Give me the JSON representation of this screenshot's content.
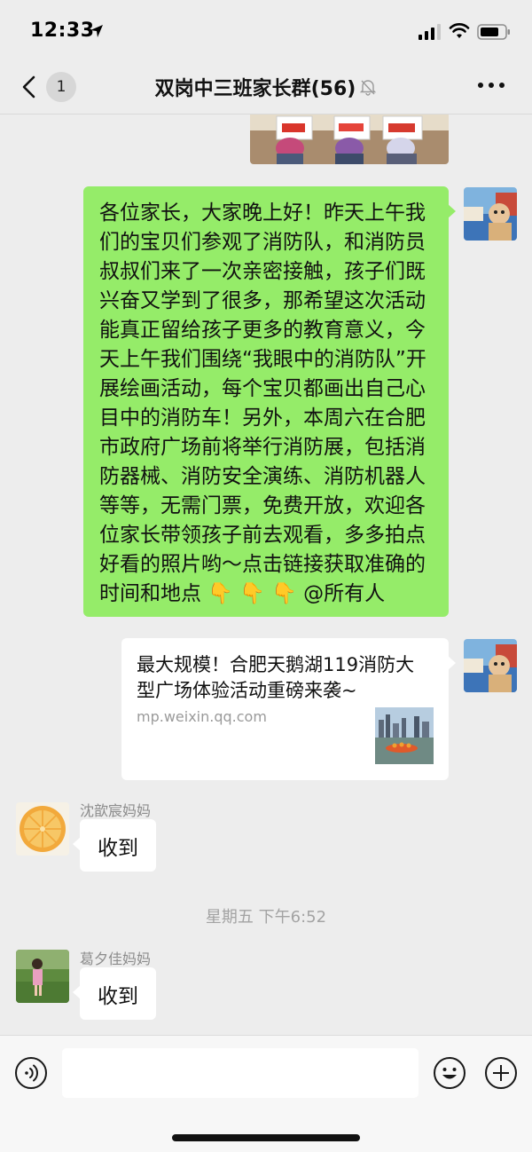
{
  "status_bar": {
    "time": "12:33",
    "icons": [
      "location-arrow-icon",
      "signal-icon",
      "wifi-icon",
      "battery-icon"
    ]
  },
  "nav": {
    "back_badge": "1",
    "title": "双岗中三班家长群(56)",
    "icons": [
      "back-chevron-icon",
      "mute-bell-icon",
      "more-dots-icon"
    ]
  },
  "messages": {
    "announcement": "各位家长，大家晚上好！昨天上午我们的宝贝们参观了消防队，和消防员叔叔们来了一次亲密接触，孩子们既兴奋又学到了很多，那希望这次活动能真正留给孩子更多的教育意义，今天上午我们围绕“我眼中的消防队”开展绘画活动，每个宝贝都画出自己心目中的消防车！另外，本周六在合肥市政府广场前将举行消防展，包括消防器械、消防安全演练、消防机器人等等，无需门票，免费开放，欢迎各位家长带领孩子前去观看，多多拍点好看的照片哟～点击链接获取准确的时间和地点 👇 👇 👇 @所有人",
    "link_card": {
      "title": "最大规模！合肥天鹅湖119消防大型广场体验活动重磅来袭~",
      "source": "mp.weixin.qq.com"
    },
    "reply1": {
      "sender": "沈歆宸妈妈",
      "text": "收到"
    },
    "time_separator": "星期五 下午6:52",
    "reply2": {
      "sender": "葛夕佳妈妈",
      "text": "收到"
    }
  },
  "input_bar": {
    "placeholder": "",
    "icons": [
      "voice-icon",
      "emoji-icon",
      "plus-icon"
    ]
  },
  "colors": {
    "sent_bubble": "#95ec69",
    "received_bubble": "#ffffff",
    "background": "#ededed"
  }
}
